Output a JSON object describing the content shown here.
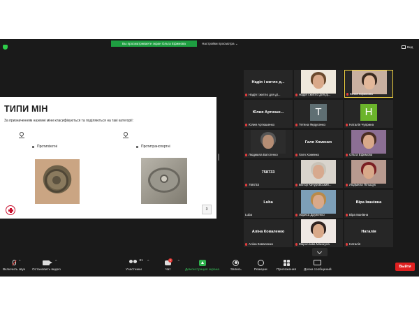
{
  "top_bar": {
    "share_banner": "Вы просматриваете экран Ольга Ефимова",
    "view_options": "Настройки просмотра",
    "view_button": "Вид"
  },
  "slide": {
    "title": "ТИПИ МІН",
    "subtitle": "За призначенням наземні міни класифікуються та поділяються на такі категорії:",
    "bullets": [
      "Протипіхотні",
      "Протитранспортні"
    ],
    "page_number": "3"
  },
  "gallery": {
    "tiles": [
      {
        "center_name": "Надія і житло д...",
        "label": "Надія і житло для ді..."
      },
      {
        "center_name": "",
        "label": "Надія і житло для ді..."
      },
      {
        "center_name": "",
        "label": "Юлия Ефимова"
      },
      {
        "center_name": "Юлия Артюше...",
        "label": "Юлия Артюшенко"
      },
      {
        "center_name": "",
        "avatar_letter": "T",
        "avatar_color": "#5f6f73",
        "label": "Тетяна Федусенко"
      },
      {
        "center_name": "",
        "avatar_letter": "Н",
        "avatar_color": "#6bb42b",
        "label": "Наталія Чуприна"
      },
      {
        "center_name": "",
        "label": "Людмила Батогенко"
      },
      {
        "center_name": "Галя Хоменко",
        "label": "Галя Хоменко"
      },
      {
        "center_name": "",
        "label": "Ольга Ефимова"
      },
      {
        "center_name": "758733",
        "label": "758733"
      },
      {
        "center_name": "",
        "label": "Віктор Качуровський..."
      },
      {
        "center_name": "",
        "label": "Людмила Пільщук"
      },
      {
        "center_name": "Luba",
        "label": "Luba"
      },
      {
        "center_name": "",
        "label": "Лариса Друженко"
      },
      {
        "center_name": "Віра Іванівна",
        "label": "Віра Іванівна"
      },
      {
        "center_name": "Аліна Коваленко",
        "label": "Аліна Коваленко"
      },
      {
        "center_name": "",
        "label": "Мирослава Манжула"
      },
      {
        "center_name": "Наталія",
        "label": "Наталія"
      }
    ]
  },
  "toolbar": {
    "unmute": "Включить звук",
    "start_video": "Остановить видео",
    "participants": "Участники",
    "participants_count": "81",
    "chat": "Чат",
    "chat_badge": "1",
    "share_screen": "Демонстрация экрана",
    "record": "Запись",
    "reactions": "Реакции",
    "apps": "Приложения",
    "whiteboards": "Доски сообщений",
    "leave": "Выйти"
  },
  "colors": {
    "meeting_bg": "#1a1a1a",
    "tile_bg": "#262626",
    "share_green": "#1e9e41",
    "active_speaker": "#f2d340",
    "leave_red": "#e02020"
  }
}
